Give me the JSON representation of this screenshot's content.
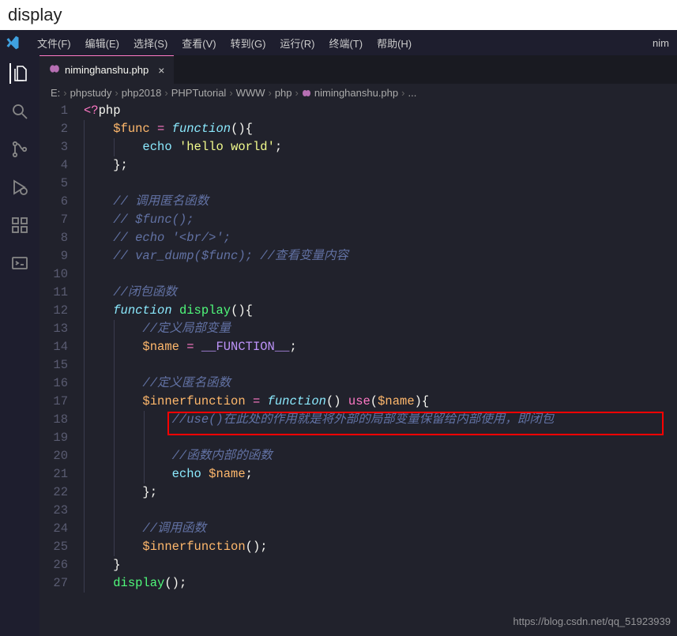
{
  "top_label": "display",
  "menubar": {
    "items": [
      "文件(F)",
      "编辑(E)",
      "选择(S)",
      "查看(V)",
      "转到(G)",
      "运行(R)",
      "终端(T)",
      "帮助(H)"
    ],
    "right": "nim"
  },
  "tab": {
    "filename": "niminghanshu.php",
    "close": "×"
  },
  "breadcrumb": {
    "parts": [
      "E:",
      "phpstudy",
      "php2018",
      "PHPTutorial",
      "WWW",
      "php",
      "niminghanshu.php",
      "..."
    ],
    "sep": "›"
  },
  "line_count": 27,
  "code": {
    "l1": {
      "a": "<?",
      "b": "php"
    },
    "l2": {
      "a": "    ",
      "b": "$func",
      "c": " = ",
      "d": "function",
      "e": "(){"
    },
    "l3": {
      "a": "        ",
      "b": "echo",
      "c": " ",
      "d": "'hello world'",
      "e": ";"
    },
    "l4": {
      "a": "    };"
    },
    "l5": "",
    "l6": {
      "a": "    ",
      "b": "// 调用匿名函数"
    },
    "l7": {
      "a": "    ",
      "b": "// $func();"
    },
    "l8": {
      "a": "    ",
      "b": "// echo '<br/>';"
    },
    "l9": {
      "a": "    ",
      "b": "// var_dump($func); //查看变量内容"
    },
    "l10": "",
    "l11": {
      "a": "    ",
      "b": "//闭包函数"
    },
    "l12": {
      "a": "    ",
      "b": "function",
      "c": " ",
      "d": "display",
      "e": "(){"
    },
    "l13": {
      "a": "        ",
      "b": "//定义局部变量"
    },
    "l14": {
      "a": "        ",
      "b": "$name",
      "c": " = ",
      "d": "__FUNCTION__",
      "e": ";"
    },
    "l15": "",
    "l16": {
      "a": "        ",
      "b": "//定义匿名函数"
    },
    "l17": {
      "a": "        ",
      "b": "$innerfunction",
      "c": " = ",
      "d": "function",
      "e": "() ",
      "f": "use",
      "g": "(",
      "h": "$name",
      "i": "){"
    },
    "l18": {
      "a": "            ",
      "b": "//use()在此处的作用就是将外部的局部变量保留给内部使用，即闭包"
    },
    "l19": "",
    "l20": {
      "a": "            ",
      "b": "//函数内部的函数"
    },
    "l21": {
      "a": "            ",
      "b": "echo",
      "c": " ",
      "d": "$name",
      "e": ";"
    },
    "l22": {
      "a": "        };"
    },
    "l23": "",
    "l24": {
      "a": "        ",
      "b": "//调用函数"
    },
    "l25": {
      "a": "        ",
      "b": "$innerfunction",
      "c": "();"
    },
    "l26": {
      "a": "    }"
    },
    "l27": {
      "a": "    ",
      "b": "display",
      "c": "();"
    }
  },
  "watermark": "https://blog.csdn.net/qq_51923939"
}
